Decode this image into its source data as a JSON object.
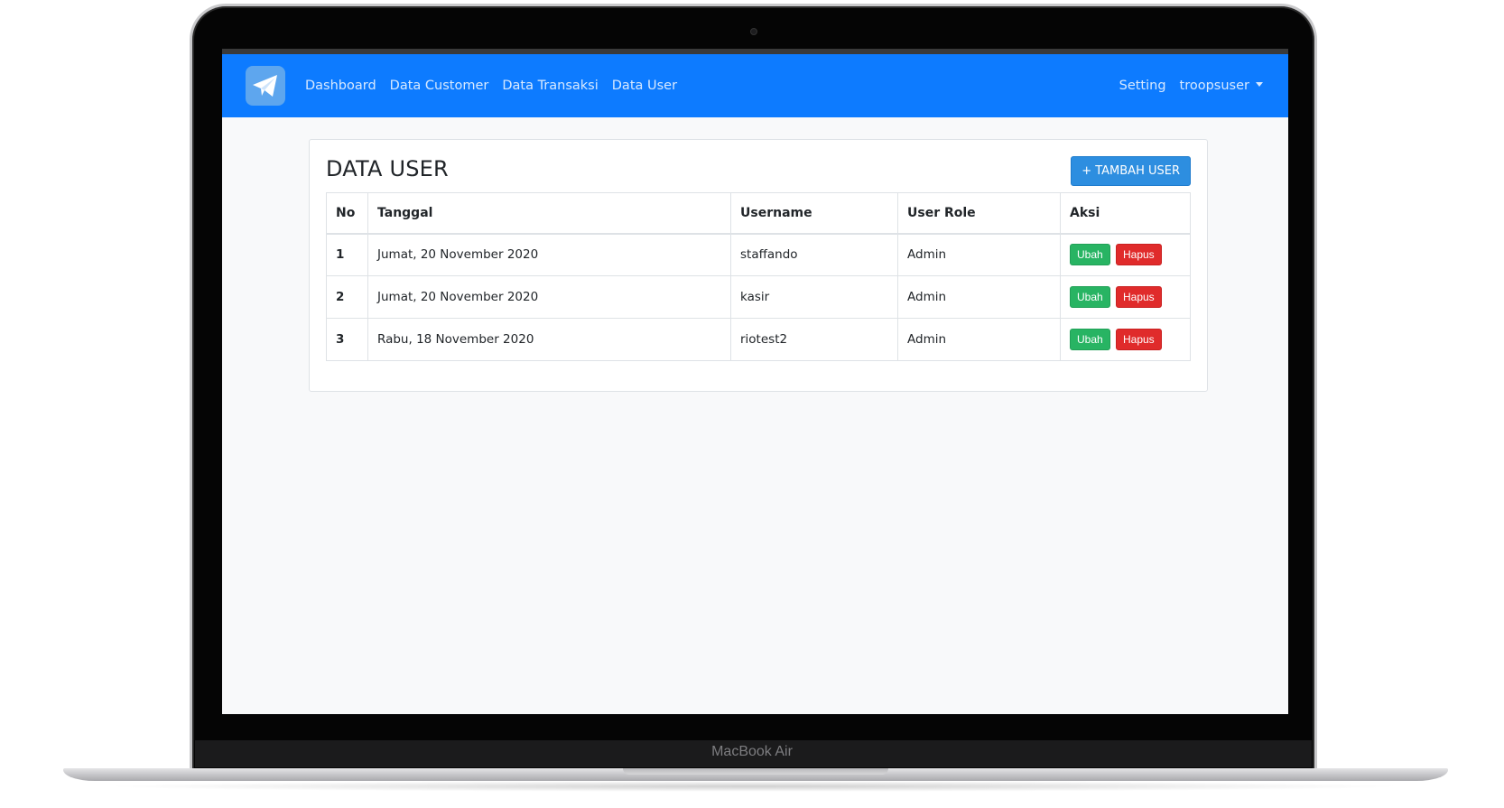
{
  "device": {
    "label": "MacBook Air"
  },
  "navbar": {
    "logo_icon": "paper-plane-icon",
    "links": [
      "Dashboard",
      "Data Customer",
      "Data Transaksi",
      "Data User"
    ],
    "setting": "Setting",
    "user": "troopsuser",
    "color": "#0d7bff"
  },
  "page": {
    "title": "DATA USER",
    "add_button": "+ TAMBAH USER"
  },
  "table": {
    "headers": [
      "No",
      "Tanggal",
      "Username",
      "User Role",
      "Aksi"
    ],
    "rows": [
      {
        "no": "1",
        "tanggal": "Jumat, 20 November 2020",
        "username": "staffando",
        "role": "Admin"
      },
      {
        "no": "2",
        "tanggal": "Jumat, 20 November 2020",
        "username": "kasir",
        "role": "Admin"
      },
      {
        "no": "3",
        "tanggal": "Rabu, 18 November 2020",
        "username": "riotest2",
        "role": "Admin"
      }
    ],
    "actions": {
      "edit": "Ubah",
      "delete": "Hapus"
    }
  }
}
